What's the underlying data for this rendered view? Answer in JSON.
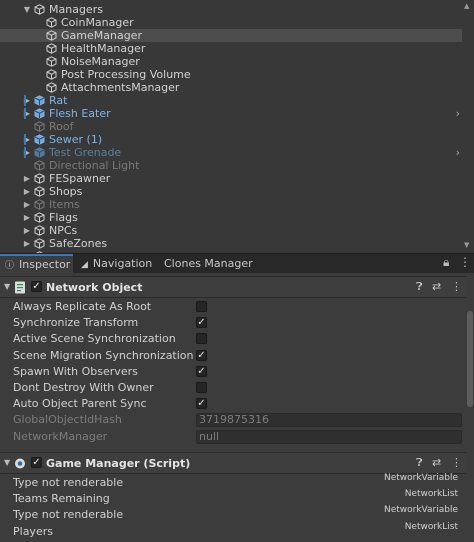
{
  "hierarchy": {
    "items": [
      {
        "label": "Managers",
        "state": "expanded",
        "style": "normal",
        "icon": "cube-icon"
      },
      {
        "label": "CoinManager",
        "state": "leaf",
        "style": "normal",
        "icon": "cube-icon"
      },
      {
        "label": "GameManager",
        "state": "leaf",
        "style": "normal",
        "icon": "cube-icon",
        "selected": true
      },
      {
        "label": "HealthManager",
        "state": "leaf",
        "style": "normal",
        "icon": "cube-icon"
      },
      {
        "label": "NoiseManager",
        "state": "leaf",
        "style": "normal",
        "icon": "cube-icon"
      },
      {
        "label": "Post Processing Volume",
        "state": "leaf",
        "style": "normal",
        "icon": "cube-icon"
      },
      {
        "label": "AttachmentsManager",
        "state": "leaf",
        "style": "normal",
        "icon": "cube-icon"
      },
      {
        "label": "Rat",
        "state": "collapsed",
        "style": "prefab",
        "icon": "prefab-cube-icon"
      },
      {
        "label": "Flesh Eater",
        "state": "collapsed",
        "style": "prefab",
        "icon": "prefab-cube-icon",
        "chevron": true
      },
      {
        "label": "Roof",
        "state": "leaf",
        "style": "dim",
        "icon": "cube-icon"
      },
      {
        "label": "Sewer (1)",
        "state": "collapsed",
        "style": "prefab",
        "icon": "prefab-cube-icon"
      },
      {
        "label": "Test Grenade",
        "state": "collapsed",
        "style": "prefab-dim",
        "icon": "prefab-cube-icon",
        "chevron": true
      },
      {
        "label": "Directional Light",
        "state": "leaf",
        "style": "dim",
        "icon": "cube-icon"
      },
      {
        "label": "FESpawner",
        "state": "collapsed",
        "style": "normal",
        "icon": "cube-icon"
      },
      {
        "label": "Shops",
        "state": "collapsed",
        "style": "normal",
        "icon": "cube-icon"
      },
      {
        "label": "Items",
        "state": "collapsed",
        "style": "dim",
        "icon": "cube-icon"
      },
      {
        "label": "Flags",
        "state": "collapsed",
        "style": "normal",
        "icon": "cube-icon"
      },
      {
        "label": "NPCs",
        "state": "collapsed",
        "style": "normal",
        "icon": "cube-icon"
      },
      {
        "label": "SafeZones",
        "state": "collapsed",
        "style": "normal",
        "icon": "cube-icon"
      },
      {
        "label": "",
        "state": "collapsed",
        "style": "normal",
        "icon": "cube-icon"
      }
    ]
  },
  "tabs": {
    "inspector": "Inspector",
    "navigation": "Navigation",
    "clones_manager": "Clones Manager"
  },
  "network_object": {
    "title": "Network Object",
    "enabled": true,
    "properties": [
      {
        "label": "Always Replicate As Root",
        "type": "checkbox",
        "checked": false
      },
      {
        "label": "Synchronize Transform",
        "type": "checkbox",
        "checked": true
      },
      {
        "label": "Active Scene Synchronization",
        "type": "checkbox",
        "checked": false
      },
      {
        "label": "Scene Migration Synchronization",
        "type": "checkbox",
        "checked": true
      },
      {
        "label": "Spawn With Observers",
        "type": "checkbox",
        "checked": true
      },
      {
        "label": "Dont Destroy With Owner",
        "type": "checkbox",
        "checked": false
      },
      {
        "label": "Auto Object Parent Sync",
        "type": "checkbox",
        "checked": true
      },
      {
        "label": "GlobalObjectIdHash",
        "type": "field",
        "value": "3719875316",
        "disabled": true
      },
      {
        "label": "NetworkManager",
        "type": "field",
        "value": "null",
        "disabled": true
      }
    ]
  },
  "game_manager": {
    "title": "Game Manager (Script)",
    "enabled": true,
    "properties": [
      {
        "label": "Type not renderable",
        "value": "NetworkVariable"
      },
      {
        "label": "Teams Remaining",
        "value": "NetworkList"
      },
      {
        "label": "Type not renderable",
        "value": "NetworkVariable"
      },
      {
        "label": "Players",
        "value": "NetworkList"
      }
    ]
  },
  "colors": {
    "selection": "#4d4d4d",
    "prefab_text": "#7cb4e8",
    "accent": "#3a79bb"
  }
}
